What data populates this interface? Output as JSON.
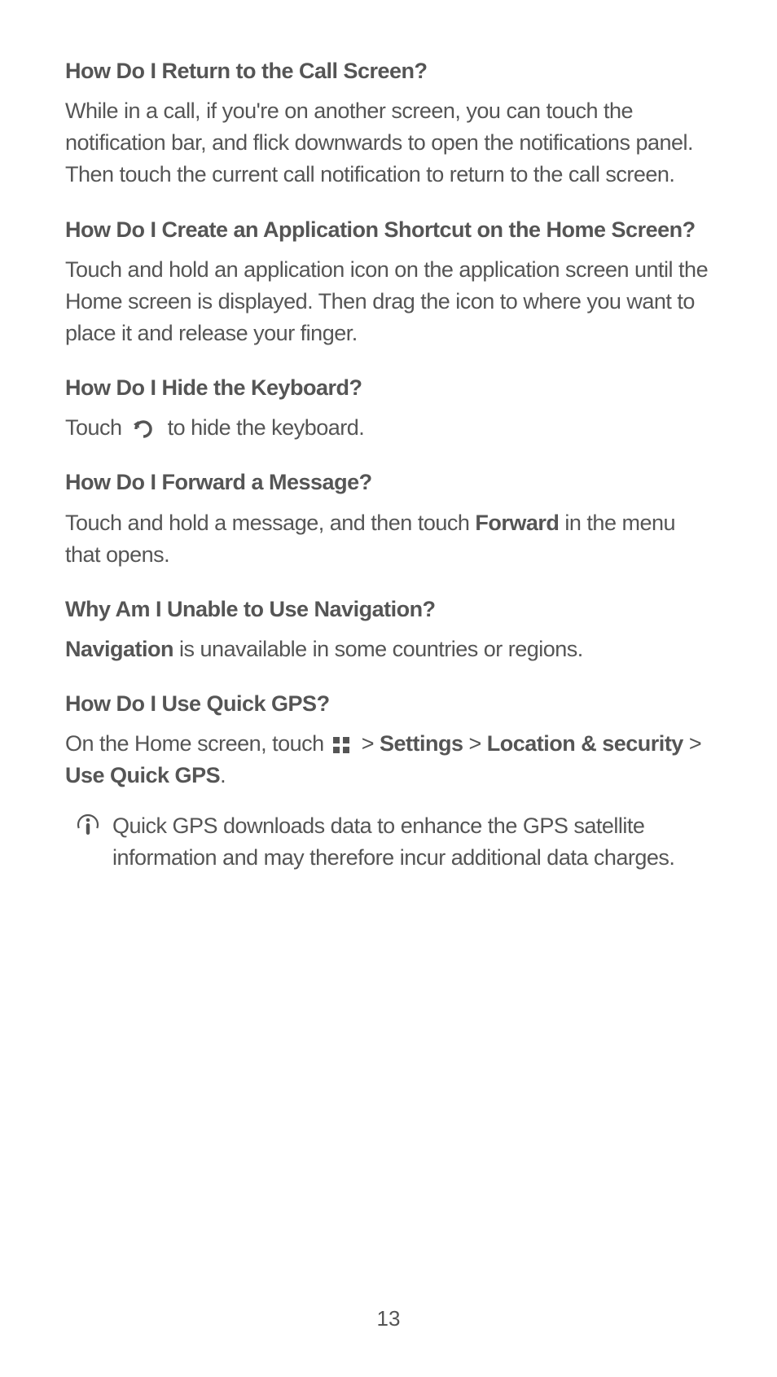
{
  "page_number": "13",
  "sections": {
    "return_call": {
      "heading": "How Do I Return to the Call Screen?",
      "body": "While in a call, if you're on another screen, you can touch the notification bar, and flick downwards to open the notifications panel. Then touch the current call notification to return to the call screen."
    },
    "shortcut": {
      "heading": "How Do I Create an Application Shortcut on the Home Screen?",
      "body": "Touch and hold an application icon on the application screen until the Home screen is displayed. Then drag the icon to where you want to place it and release your finger."
    },
    "hide_keyboard": {
      "heading": "How Do I Hide the Keyboard?",
      "body_pre": "Touch ",
      "body_post": " to hide the keyboard."
    },
    "forward_message": {
      "heading": "How Do I Forward a Message?",
      "body_pre": "Touch and hold a message, and then touch ",
      "body_bold": "Forward",
      "body_post": " in the menu that opens."
    },
    "navigation": {
      "heading": "Why Am I Unable to Use Navigation?",
      "body_bold": "Navigation",
      "body_post": " is unavailable in some countries or regions."
    },
    "quick_gps": {
      "heading": "How Do I Use Quick GPS?",
      "body_pre": "On the Home screen, touch ",
      "sep1": "  > ",
      "bold1": "Settings",
      "sep2": " > ",
      "bold2": "Location & security",
      "sep3": " > ",
      "bold3": "Use Quick GPS",
      "period": "."
    },
    "note": {
      "text": "Quick GPS downloads data to enhance the GPS satellite information and may therefore incur additional data charges."
    }
  }
}
